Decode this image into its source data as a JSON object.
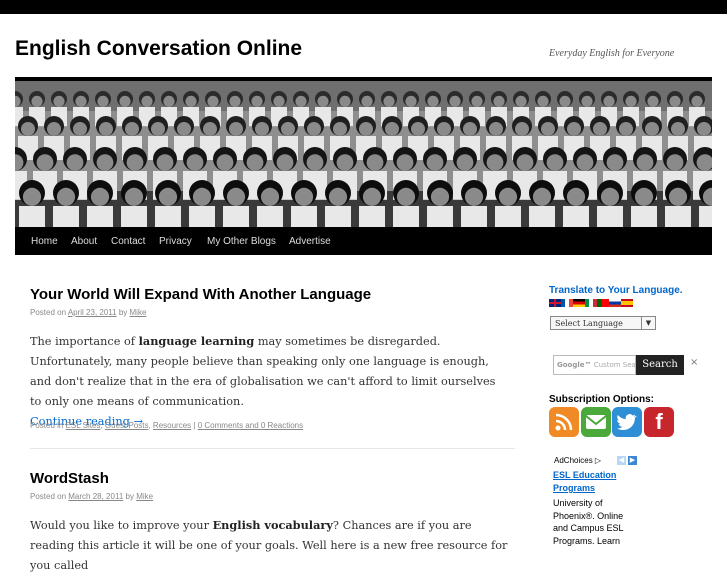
{
  "site": {
    "title": "English Conversation Online",
    "tagline": "Everyday English for Everyone"
  },
  "nav": [
    "Home",
    "About",
    "Contact",
    "Privacy",
    "My Other Blogs",
    "Advertise"
  ],
  "posts": [
    {
      "title": "Your World Will Expand With Another Language",
      "posted_on": "Posted on",
      "date": "April 23, 2011",
      "by": "by",
      "author": "Mike",
      "body_1": "The importance of ",
      "body_bold": "language learning",
      "body_2": " may sometimes be disregarded. Unfortunately, many people believe than speaking only one language is enough, and don't realize that in the era of globalisation we can't afford to limit ourselves to only one means of communication.",
      "more": "Continue reading →",
      "posted_in": "Posted in",
      "cat1": "ESL Sites",
      "cat2": "Guest Posts",
      "cat3": "Resources",
      "pipe": "|",
      "comments": "0 Comments and 0 Reactions"
    },
    {
      "title": "WordStash",
      "posted_on": "Posted on",
      "date": "March 28, 2011",
      "by": "by",
      "author": "Mike",
      "body_1": "Would you like to improve your ",
      "body_bold": "English vocabulary",
      "body_2": "? Chances are if you are reading this article it will be one of your goals. Well here is a new free resource for you called"
    }
  ],
  "sidebar": {
    "translate_title": "Translate to Your Language.",
    "select_language": "Select Language",
    "search_placeholder": "Custom Search",
    "search_button": "Search",
    "clear": "×",
    "subscription_title": "Subscription Options:",
    "adchoices": "AdChoices",
    "ad_link": "ESL Education Programs",
    "ad_text": "University of Phoenix®. Online and Campus ESL Programs. Learn"
  },
  "colors": {
    "link": "#0066cc",
    "nav_bg": "#000000",
    "rss": "#f08a24",
    "email": "#4aa93a",
    "twitter": "#2e8fd6",
    "facebook": "#c8262d"
  },
  "icons": [
    "rss-icon",
    "email-icon",
    "twitter-icon",
    "facebook-icon"
  ]
}
